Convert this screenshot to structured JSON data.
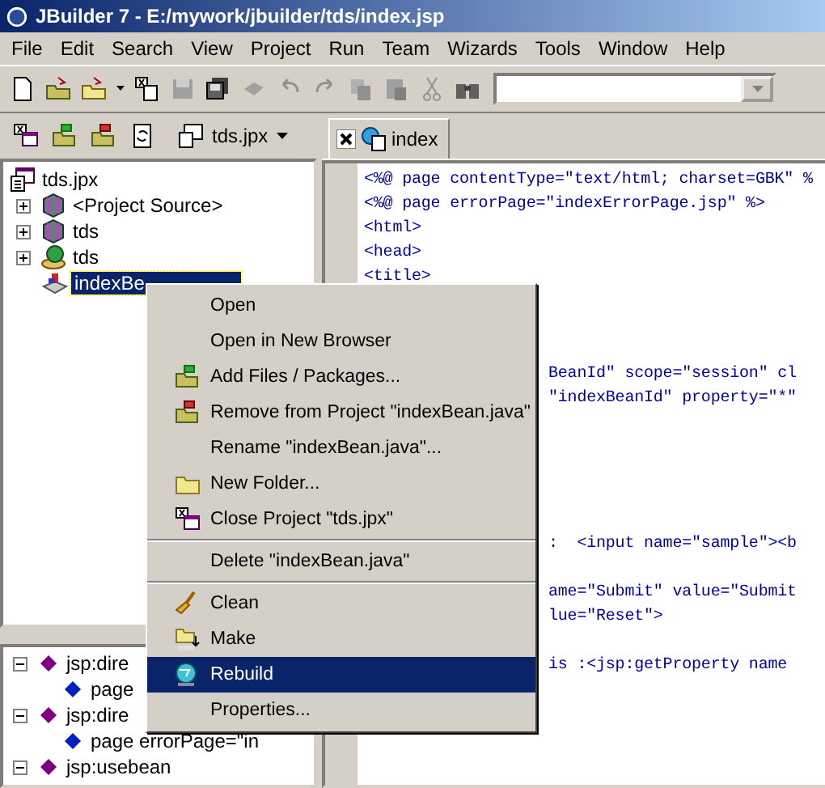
{
  "window": {
    "title": "JBuilder 7 - E:/mywork/jbuilder/tds/index.jsp"
  },
  "menu_bar": [
    "File",
    "Edit",
    "Search",
    "View",
    "Project",
    "Run",
    "Team",
    "Wizards",
    "Tools",
    "Window",
    "Help"
  ],
  "project_selector": {
    "label": "tds.jpx"
  },
  "editor_tabs": [
    {
      "label": "index",
      "selected": true
    }
  ],
  "project_tree": {
    "label": "tds.jpx",
    "children": [
      {
        "label": "<Project Source>",
        "expanded": false,
        "selected": false
      },
      {
        "label": "tds",
        "expanded": false,
        "selected": false
      },
      {
        "label": "tds",
        "expanded": false,
        "selected": false
      },
      {
        "label": "indexBe",
        "selected": true
      }
    ]
  },
  "structure_tree": [
    {
      "label": "jsp:dire",
      "expanded": true,
      "children": [
        {
          "label": "page"
        }
      ]
    },
    {
      "label": "jsp:dire",
      "expanded": true,
      "children": [
        {
          "label": "page errorPage=\"in"
        }
      ]
    },
    {
      "label": "jsp:usebean",
      "expanded": true
    }
  ],
  "editor_lines": [
    {
      "kind": "full",
      "text": "<%@ page contentType=\"text/html; charset=GBK\" %"
    },
    {
      "kind": "full",
      "text": "<%@ page errorPage=\"indexErrorPage.jsp\" %>"
    },
    {
      "kind": "full",
      "text": "<html>"
    },
    {
      "kind": "full",
      "text": "<head>"
    },
    {
      "kind": "full",
      "text": "<title>"
    },
    {
      "kind": "partial",
      "text": "BeanId\" scope=\"session\" cl"
    },
    {
      "kind": "partial",
      "text": "\"indexBeanId\" property=\"*\""
    },
    {
      "kind": "partial",
      "text": ":  <input name=\"sample\"><b"
    },
    {
      "kind": "partial",
      "text": "ame=\"Submit\" value=\"Submit"
    },
    {
      "kind": "partial",
      "text": "lue=\"Reset\">"
    },
    {
      "kind": "partial",
      "text": "is :<jsp:getProperty name"
    }
  ],
  "context_menu": [
    {
      "label": "Open",
      "selected": false
    },
    {
      "label": "Open in New Browser",
      "selected": false
    },
    {
      "label": "Add Files / Packages...",
      "selected": false
    },
    {
      "label": "Remove from Project \"indexBean.java\"",
      "selected": false
    },
    {
      "label": "Rename \"indexBean.java\"...",
      "selected": false
    },
    {
      "label": "New Folder...",
      "selected": false
    },
    {
      "label": "Close Project \"tds.jpx\"",
      "selected": false
    },
    {
      "label": "Delete \"indexBean.java\"",
      "selected": false
    },
    {
      "label": "Clean",
      "selected": false
    },
    {
      "label": "Make",
      "selected": false
    },
    {
      "label": "Rebuild",
      "selected": true
    },
    {
      "label": "Properties...",
      "selected": false
    }
  ]
}
